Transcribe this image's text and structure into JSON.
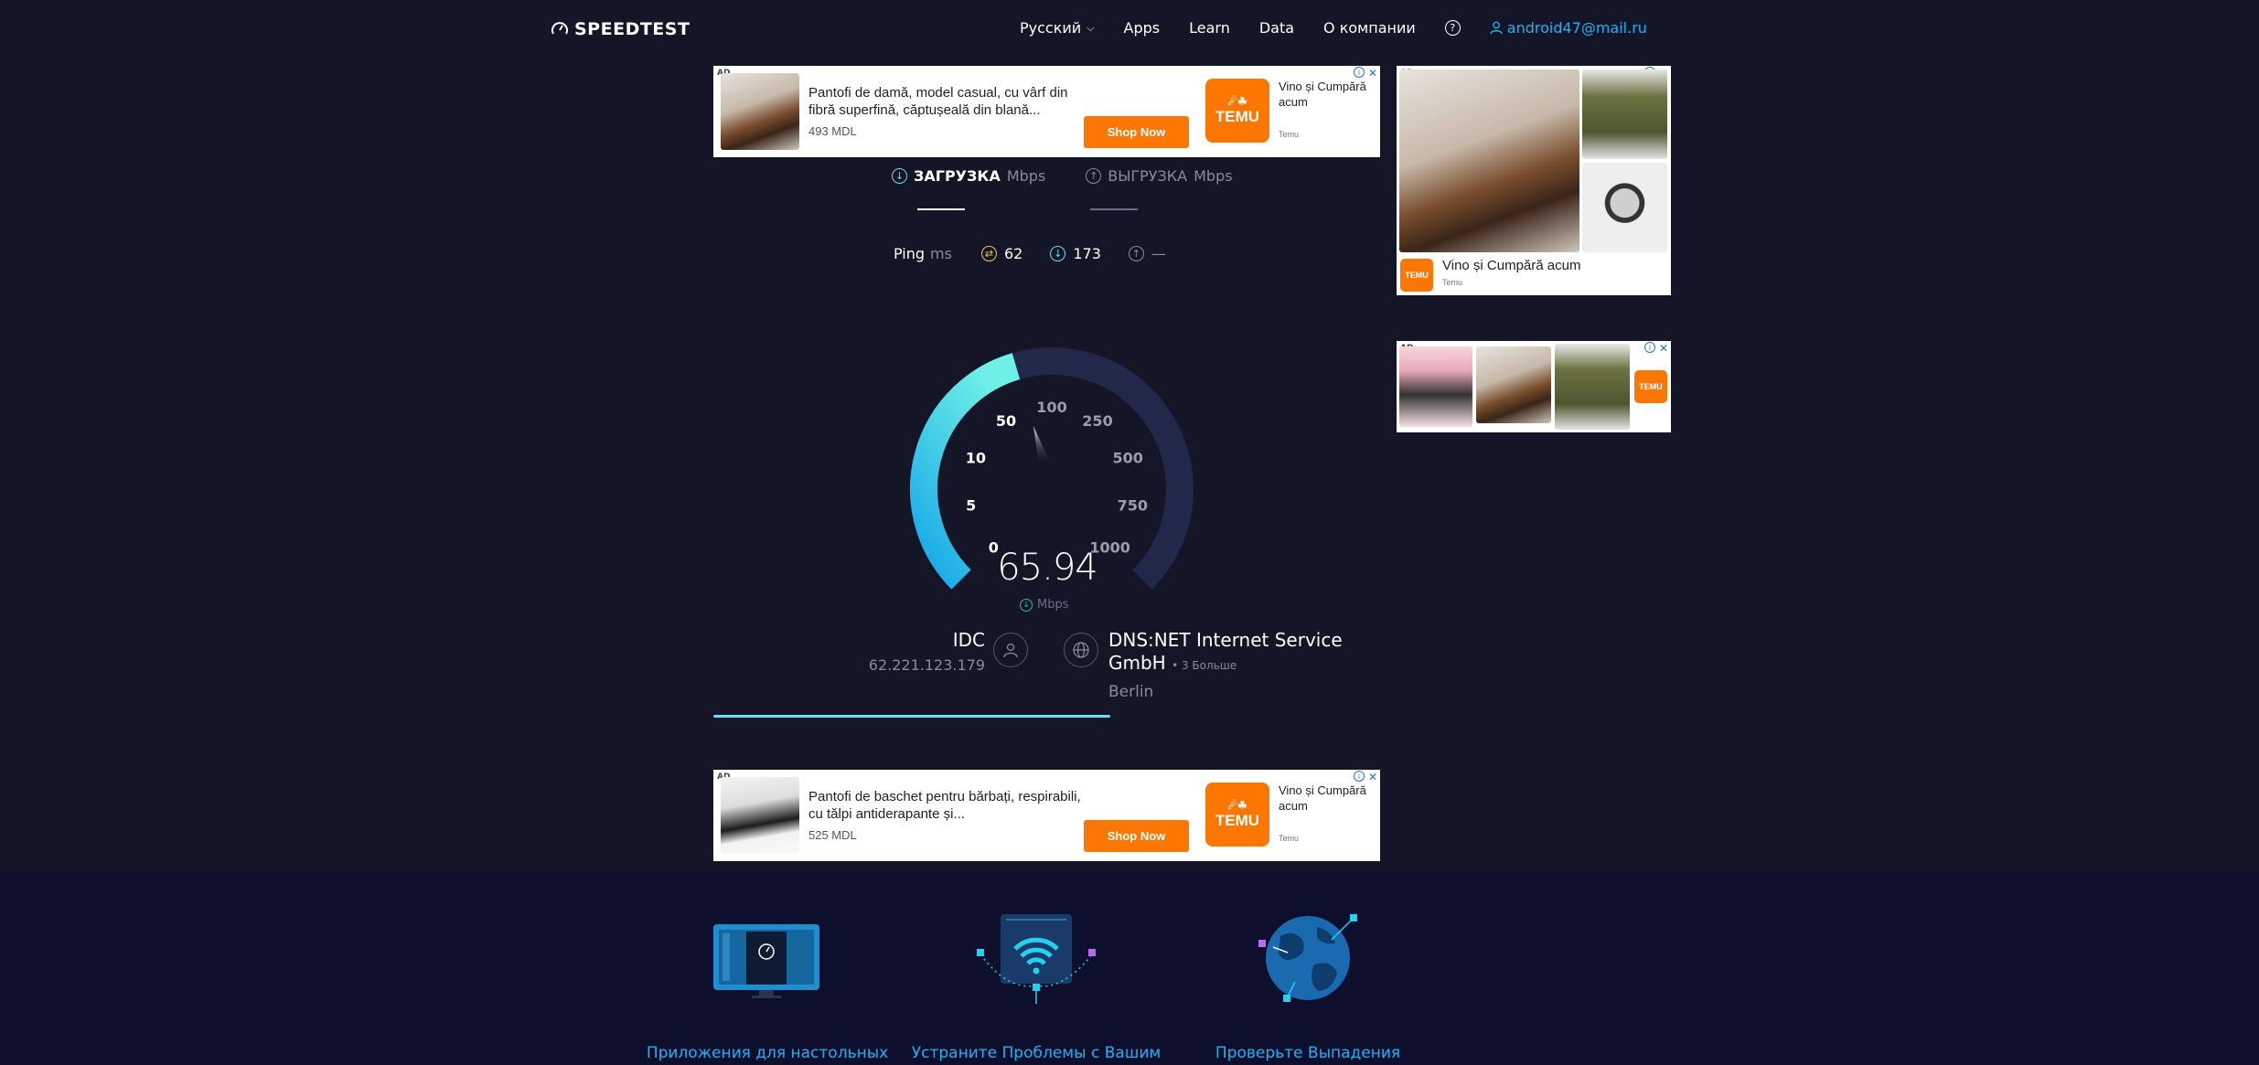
{
  "header": {
    "logo_text": "SPEEDTEST",
    "nav": {
      "language": "Русский",
      "apps": "Apps",
      "learn": "Learn",
      "data": "Data",
      "about": "О компании",
      "help": "?",
      "user": "android47@mail.ru"
    }
  },
  "ads": {
    "badge": "AD",
    "top": {
      "text": "Pantofi de damă, model casual, cu vârf din fibră superfină, căptușeală din blană...",
      "price": "493 MDL",
      "button": "Shop Now",
      "side_text": "Vino și Cumpără acum",
      "brand": "Temu"
    },
    "right_top": {
      "caption": "Vino și Cumpără acum",
      "brand": "Temu"
    },
    "bottom": {
      "text": "Pantofi de baschet pentru bărbați, respirabili, cu tălpi antiderapante și...",
      "price": "525 MDL",
      "button": "Shop Now",
      "side_text": "Vino și Cumpără acum",
      "brand": "Temu"
    },
    "temu_logo": "TEMU"
  },
  "tabs": {
    "download_label": "ЗАГРУЗКА",
    "download_unit": "Mbps",
    "upload_label": "ВЫГРУЗКА",
    "upload_unit": "Mbps"
  },
  "ping": {
    "label": "Ping",
    "unit": "ms",
    "idle": "62",
    "download": "173",
    "upload": "—"
  },
  "gauge": {
    "ticks": [
      "0",
      "5",
      "10",
      "50",
      "100",
      "250",
      "500",
      "750",
      "1000"
    ],
    "speed": "65.94",
    "unit": "Mbps",
    "needle_fraction": 0.44
  },
  "isp": {
    "name": "IDC",
    "ip": "62.221.123.179"
  },
  "server": {
    "name": "DNS:NET Internet Service GmbH",
    "more": "• 3 Больше",
    "city": "Berlin"
  },
  "progress": 0.75,
  "colors": {
    "background": "#141526",
    "accent": "#6bdcf0",
    "link": "#1bb3f5",
    "footer": "#0e0f2c"
  },
  "features": [
    {
      "label": "Приложения для настольных"
    },
    {
      "label": "Устраните Проблемы с Вашим"
    },
    {
      "label": "Проверьте Выпадения"
    }
  ]
}
